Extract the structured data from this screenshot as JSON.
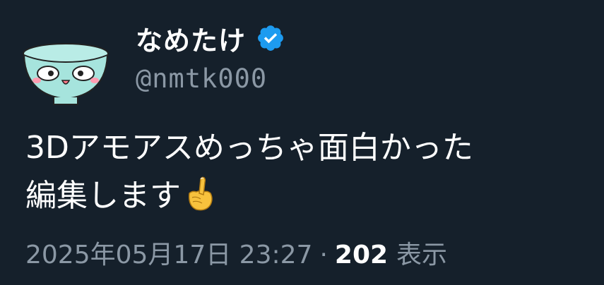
{
  "user": {
    "display_name": "なめたけ",
    "handle": "@nmtk000",
    "verified": true
  },
  "tweet": {
    "text_line1": "3Dアモアスめっちゃ面白かった",
    "text_line2": "編集します",
    "emoji": "☝️"
  },
  "meta": {
    "timestamp": "2025年05月17日 23:27",
    "separator": "·",
    "view_count": "202",
    "views_label": "表示"
  },
  "colors": {
    "background": "#15202b",
    "text_primary": "#ffffff",
    "text_secondary": "#8b98a5",
    "verified_blue": "#1d9bf0"
  },
  "icons": {
    "avatar": "bowl-character-avatar",
    "verified": "verified-badge-icon",
    "emoji": "pointing-up-emoji"
  }
}
